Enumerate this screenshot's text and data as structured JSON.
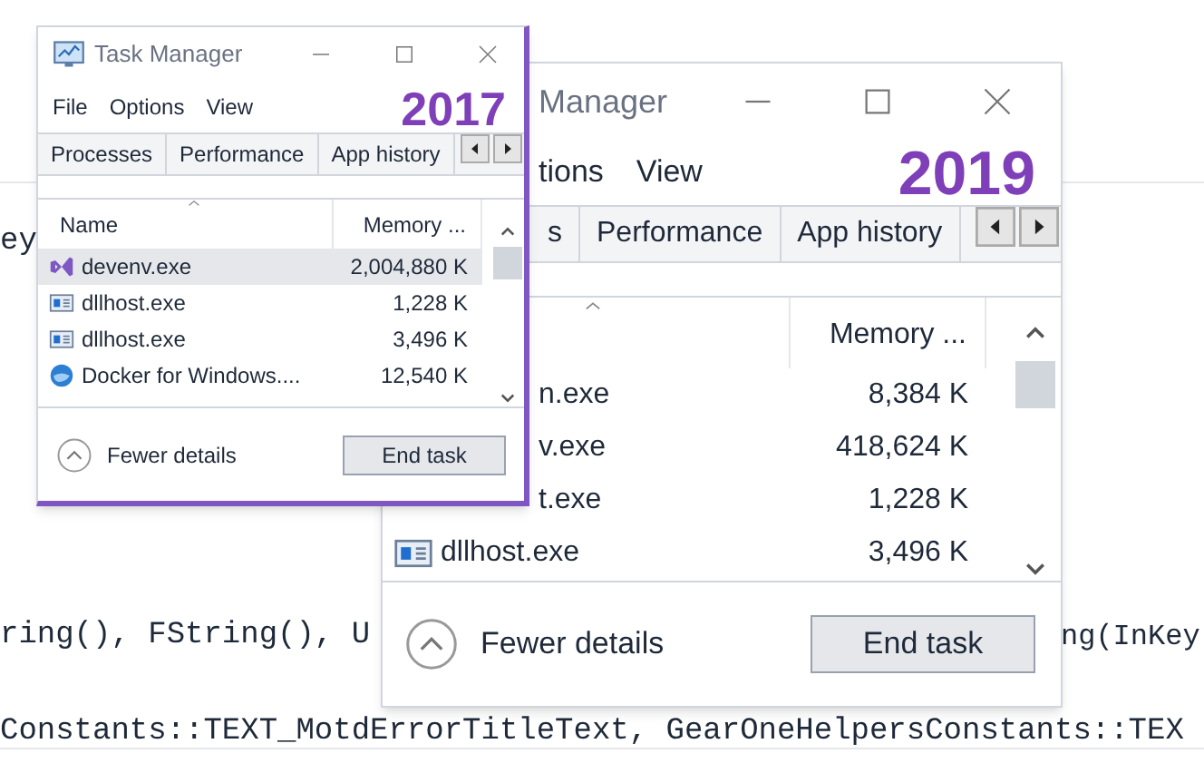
{
  "code_lines": [
    {
      "text": "ey"
    },
    {
      "text": "ring(), FString(), U"
    },
    {
      "text": "ng(InKey"
    },
    {
      "text": "Constants::TEXT_MotdErrorTitleText, GearOneHelpersConstants::TEX"
    }
  ],
  "windows": [
    {
      "label": "2017",
      "title": "Task Manager",
      "menu": [
        "File",
        "Options",
        "View"
      ],
      "tabs": [
        "Processes",
        "Performance",
        "App history"
      ],
      "columns": [
        {
          "kind": "name",
          "label": "Name"
        },
        {
          "kind": "memory",
          "label": "Memory ..."
        }
      ],
      "rows": [
        {
          "kind": "vs",
          "name": "devenv.exe",
          "memory": "2,004,880 K",
          "selected": true
        },
        {
          "kind": "window",
          "name": "dllhost.exe",
          "memory": "1,228 K",
          "selected": false
        },
        {
          "kind": "window",
          "name": "dllhost.exe",
          "memory": "3,496 K",
          "selected": false
        },
        {
          "kind": "docker",
          "name": "Docker for Windows....",
          "memory": "12,540 K",
          "selected": false
        }
      ],
      "toggle": "Fewer details",
      "button": "End task"
    },
    {
      "label": "2019",
      "title": "Manager",
      "menu": [
        "tions",
        "View"
      ],
      "tabs": [
        "s",
        "Performance",
        "App history"
      ],
      "columns": [
        {
          "kind": "memory",
          "label": "Memory ..."
        }
      ],
      "rows": [
        {
          "kind": "cut",
          "name": "n.exe",
          "memory": "8,384 K",
          "selected": false
        },
        {
          "kind": "cut",
          "name": "v.exe",
          "memory": "418,624 K",
          "selected": false
        },
        {
          "kind": "cut",
          "name": "t.exe",
          "memory": "1,228 K",
          "selected": false
        },
        {
          "kind": "window",
          "name": "dllhost.exe",
          "memory": "3,496 K",
          "selected": false
        }
      ],
      "toggle": "Fewer details",
      "button": "End task"
    }
  ]
}
